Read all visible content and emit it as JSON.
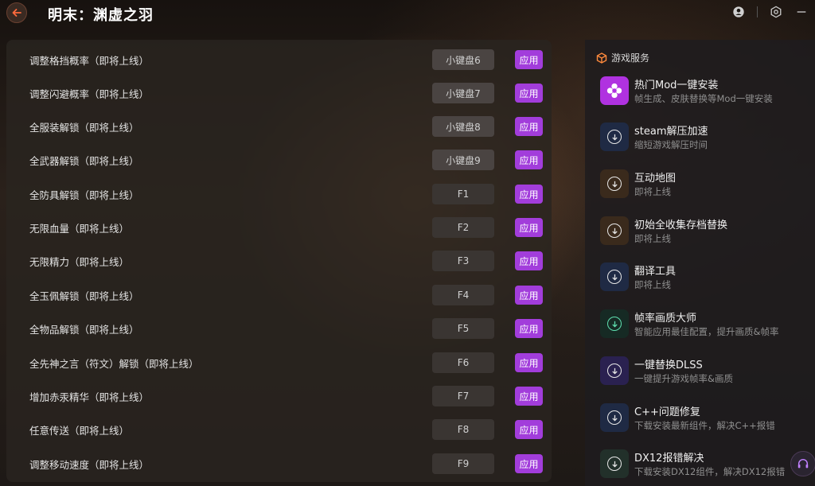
{
  "header": {
    "title": "明末：渊虚之羽",
    "back_icon": "back-arrow-icon",
    "icons": [
      "user-icon",
      "settings-icon",
      "minimize-icon"
    ]
  },
  "colors": {
    "accent": "#a23ddb",
    "back_arrow": "#ff6a3d"
  },
  "cheats": [
    {
      "label": "调整格挡概率（即将上线）",
      "hotkey": "小键盘6",
      "apply": "应用"
    },
    {
      "label": "调整闪避概率（即将上线）",
      "hotkey": "小键盘7",
      "apply": "应用"
    },
    {
      "label": "全服装解锁（即将上线）",
      "hotkey": "小键盘8",
      "apply": "应用"
    },
    {
      "label": "全武器解锁（即将上线）",
      "hotkey": "小键盘9",
      "apply": "应用"
    },
    {
      "label": "全防具解锁（即将上线）",
      "hotkey": "F1",
      "apply": "应用"
    },
    {
      "label": "无限血量（即将上线）",
      "hotkey": "F2",
      "apply": "应用"
    },
    {
      "label": "无限精力（即将上线）",
      "hotkey": "F3",
      "apply": "应用"
    },
    {
      "label": "全玉佩解锁（即将上线）",
      "hotkey": "F4",
      "apply": "应用"
    },
    {
      "label": "全物品解锁（即将上线）",
      "hotkey": "F5",
      "apply": "应用"
    },
    {
      "label": "全先神之言（符文）解锁（即将上线）",
      "hotkey": "F6",
      "apply": "应用"
    },
    {
      "label": "增加赤汞精华（即将上线）",
      "hotkey": "F7",
      "apply": "应用"
    },
    {
      "label": "任意传送（即将上线）",
      "hotkey": "F8",
      "apply": "应用"
    },
    {
      "label": "调整移动速度（即将上线）",
      "hotkey": "F9",
      "apply": "应用"
    }
  ],
  "services": {
    "header": "游戏服务",
    "header_icon": "cube-icon",
    "items": [
      {
        "title": "热门Mod一键安装",
        "subtitle": "帧生成、皮肤替换等Mod一键安装",
        "icon": "mod-flower-icon"
      },
      {
        "title": "steam解压加速",
        "subtitle": "缩短游戏解压时间",
        "icon": "download-icon"
      },
      {
        "title": "互动地图",
        "subtitle": "即将上线",
        "icon": "download-icon"
      },
      {
        "title": "初始全收集存档替换",
        "subtitle": "即将上线",
        "icon": "download-icon"
      },
      {
        "title": "翻译工具",
        "subtitle": "即将上线",
        "icon": "download-icon"
      },
      {
        "title": "帧率画质大师",
        "subtitle": "智能应用最佳配置，提升画质&帧率",
        "icon": "download-icon"
      },
      {
        "title": "一键替换DLSS",
        "subtitle": "一键提升游戏帧率&画质",
        "icon": "download-icon"
      },
      {
        "title": "C++问题修复",
        "subtitle": "下载安装最新组件，解决C++报错",
        "icon": "download-icon"
      },
      {
        "title": "DX12报错解决",
        "subtitle": "下载安装DX12组件，解决DX12报错",
        "icon": "download-icon"
      }
    ]
  },
  "support_icon": "headset-icon"
}
